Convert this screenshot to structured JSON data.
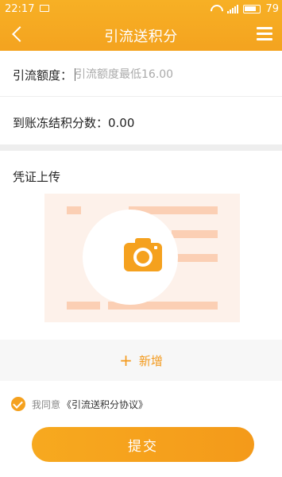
{
  "status_bar": {
    "time": "22:17",
    "battery": "79"
  },
  "header": {
    "title": "引流送积分",
    "back_icon": "chevron-left-icon",
    "menu_icon": "hamburger-menu-icon"
  },
  "form": {
    "amount_label": "引流额度：",
    "amount_placeholder": "引流额度最低16.00",
    "frozen_text": "到账冻结积分数：0.00"
  },
  "upload": {
    "title": "凭证上传",
    "camera_icon": "camera-icon"
  },
  "actions": {
    "add_label": "新增",
    "add_icon": "+",
    "submit_label": "提交"
  },
  "agreement": {
    "prefix": "我同意",
    "link": "《引流送积分协议》"
  },
  "colors": {
    "accent": "#f5a11e",
    "card_bg": "#fdf1ea",
    "card_bars": "#fbcfb4"
  }
}
